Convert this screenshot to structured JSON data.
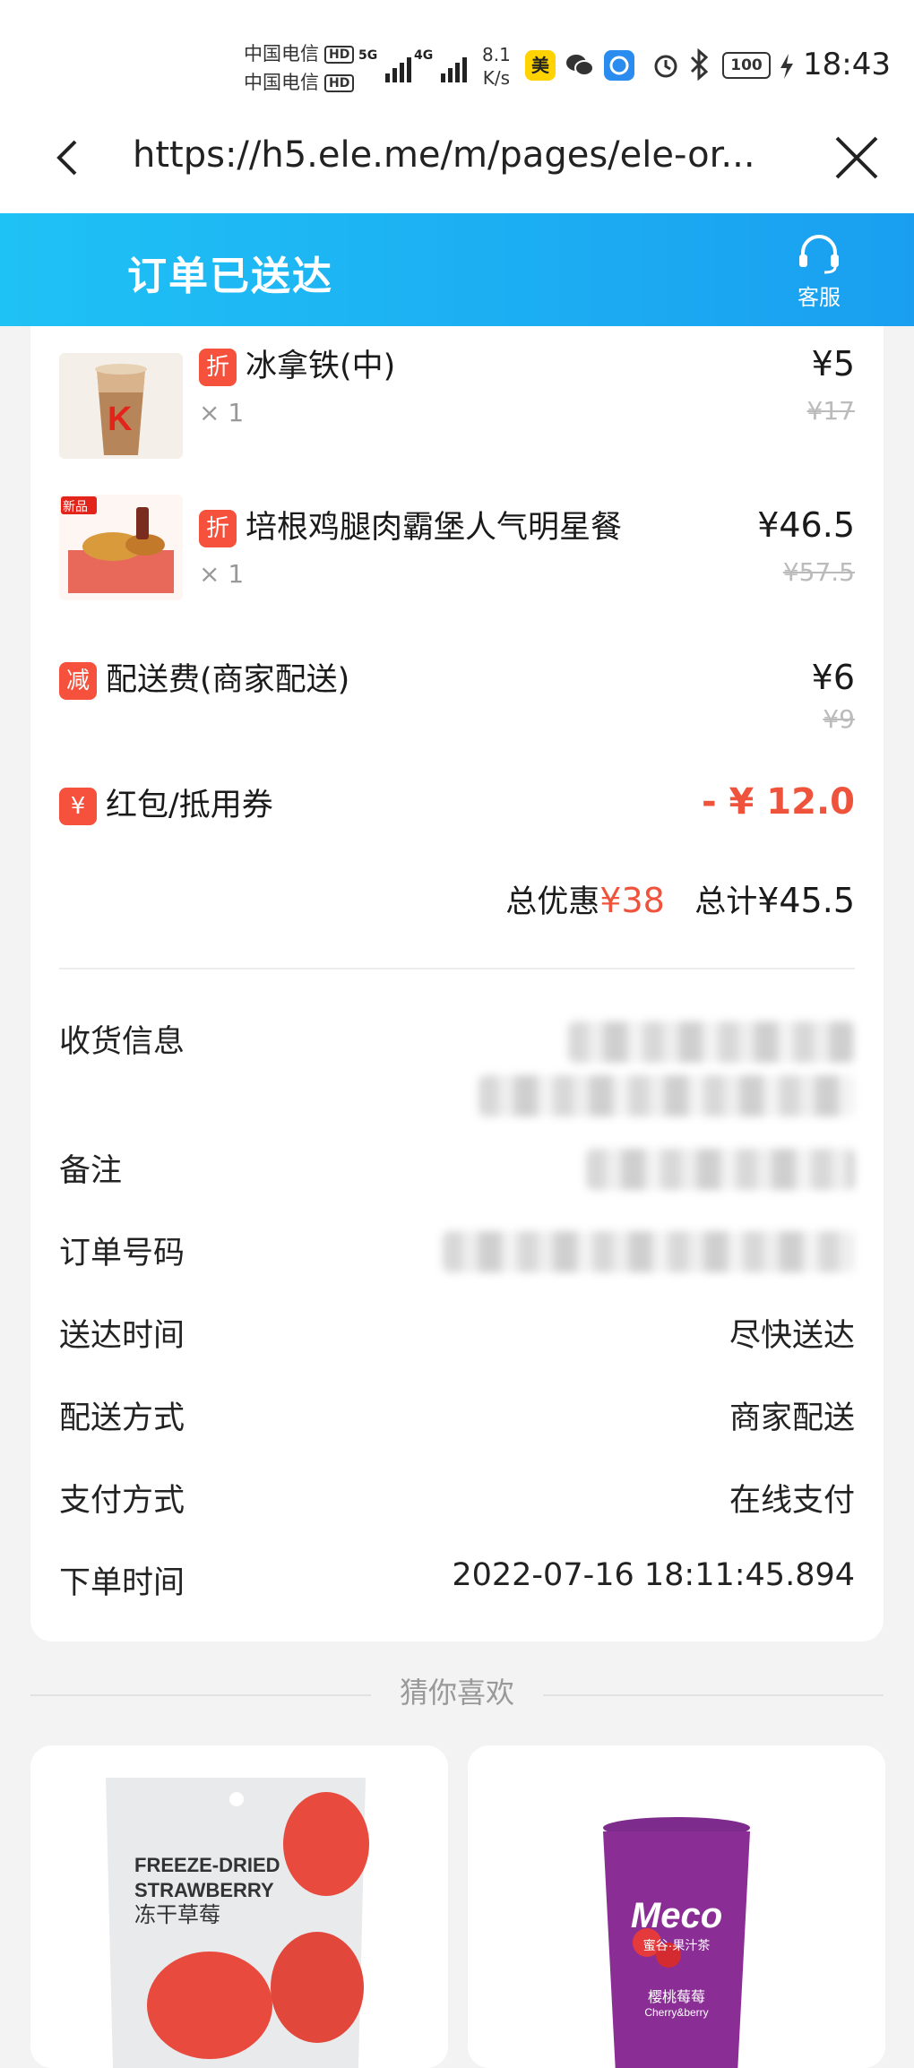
{
  "status_bar": {
    "carrier_1": "中国电信",
    "carrier_2": "中国电信",
    "hd_badge": "HD",
    "network_1": "5G",
    "network_2": "4G",
    "speed_value": "8.1",
    "speed_unit": "K/s",
    "meituan_app": "美",
    "battery": "100",
    "time": "18:43"
  },
  "browser": {
    "url": "https://h5.ele.me/m/pages/ele-or..."
  },
  "header": {
    "title": "订单已送达",
    "service_label": "客服",
    "colors": {
      "start": "#1fc2f5",
      "end": "#1a9ff0"
    }
  },
  "items": [
    {
      "tag": "折",
      "name": "冰拿铁(中)",
      "qty": "× 1",
      "price": "¥5",
      "original": "¥17",
      "thumb": "iced-latte-icon"
    },
    {
      "tag": "折",
      "name": "培根鸡腿肉霸堡人气明星餐",
      "qty": "× 1",
      "price": "¥46.5",
      "original": "¥57.5",
      "thumb": "burger-meal-icon",
      "badge": "新品"
    }
  ],
  "fees": {
    "delivery": {
      "tag": "减",
      "label": "配送费(商家配送)",
      "price": "¥6",
      "original": "¥9"
    },
    "coupon": {
      "tag": "¥",
      "label": "红包/抵用券",
      "amount": "- ¥ 12.0"
    }
  },
  "totals": {
    "discount_label": "总优惠",
    "discount_value": "¥38",
    "total_label": "总计",
    "total_value": "¥45.5"
  },
  "info_rows": {
    "address_label": "收货信息",
    "remark_label": "备注",
    "order_no_label": "订单号码",
    "delivery_time_label": "送达时间",
    "delivery_time_value": "尽快送达",
    "delivery_method_label": "配送方式",
    "delivery_method_value": "商家配送",
    "payment_label": "支付方式",
    "payment_value": "在线支付",
    "order_time_label": "下单时间",
    "order_time_value": "2022-07-16 18:11:45.894"
  },
  "recommend": {
    "title": "猜你喜欢",
    "card_1": {
      "line_1": "FREEZE-DRIED",
      "line_2": "STRAWBERRY",
      "line_3": "冻干草莓"
    },
    "card_2": {
      "brand": "Meco",
      "sub": "蜜谷·果汁茶",
      "flavor": "樱桃莓莓",
      "flavor_en": "Cherry&berry"
    }
  },
  "accent_red": "#f0533c"
}
